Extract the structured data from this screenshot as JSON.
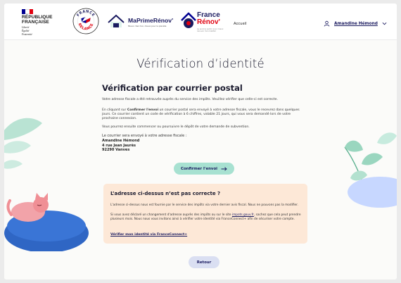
{
  "header": {
    "republique_lines": [
      "RÉPUBLIQUE",
      "FRANÇAISE"
    ],
    "devise_lines": [
      "Liberté",
      "Égalité",
      "Fraternité"
    ],
    "france_relance_lines": [
      "FRANCE",
      "RELANCE"
    ],
    "maprimerenov_title": "MaPrimeRénov'",
    "maprimerenov_subtitle": "Mieux chez moi, mieux pour la planète",
    "france_renov_line1": "France",
    "france_renov_line2": "Rénov'",
    "france_renov_subtitle": "Le service public pour mieux rénover mon habitat",
    "nav_accueil": "Accueil",
    "user_name": "Amandine Hémond",
    "user_icon": "user-icon",
    "menu_icon": "chevron-down-icon"
  },
  "main": {
    "title": "Vérification d’identité",
    "section_title": "Vérification par courrier postal",
    "p1": "Votre adresse fiscale a été retrouvée auprès du service des impôts. Veuillez vérifier que celle-ci est correcte.",
    "p2_prefix": "En cliquant sur ",
    "p2_strong": "Confirmer l'envoi",
    "p2_suffix": " un courrier postal sera envoyé à votre adresse fiscale, vous le recevrez dans quelques jours. Ce courrier contient un code de vérification à 6 chiffres, valable 21 jours, qui vous sera demandé lors de votre prochaine connexion.",
    "p3": "Vous pourrez ensuite commencer ou poursuivre le dépôt de votre demande de subvention.",
    "address_label": "Le courrier sera envoyé à votre adresse fiscale :",
    "address_lines": [
      "Amandine Hémond",
      "4 rue Jean Jaurès",
      "92290 Vanves"
    ],
    "confirm_button": "Confirmer l'envoi",
    "confirm_icon": "arrow-right-icon"
  },
  "warning": {
    "title": "L’adresse ci-dessus n’est pas correcte ?",
    "p1": "L'adresse ci-dessus nous est fournie par le service des impôts via votre dernier avis fiscal. Nous ne pouvons pas la modifier.",
    "p2_prefix": "Si vous avez déclaré un changement d'adresse auprès des impôts ou sur le site ",
    "p2_link": "impots.gouv.fr",
    "p2_suffix": ", sachez que cela peut prendre plusieurs mois. Nous nous vous invitons ainsi à vérifier votre identité via FranceConnect+ afin de sécuriser votre compte.",
    "link": "Vérifier mon identité via FranceConnect+"
  },
  "footer": {
    "back_button": "Retour"
  },
  "colors": {
    "navy": "#1b1b60",
    "confirm_bg": "#a7e1d1",
    "warning_bg": "#fde8d7",
    "back_bg": "#dadff2",
    "rf_red": "#e1000f",
    "rf_blue": "#000091"
  }
}
